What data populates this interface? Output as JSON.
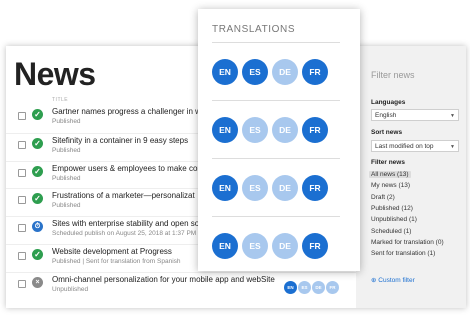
{
  "page": {
    "title": "News",
    "column_header": "TITLE"
  },
  "news": [
    {
      "title": "Gartner names progress a challenger in web",
      "status": "Published",
      "state": "published"
    },
    {
      "title": "Sitefinity in a container in 9 easy steps",
      "status": "Published",
      "state": "published"
    },
    {
      "title": "Empower users & employees to make conte",
      "status": "Published",
      "state": "published"
    },
    {
      "title": "Frustrations of a marketer—personalizat",
      "status": "Published",
      "state": "published"
    },
    {
      "title": "Sites with enterprise stability and open sour",
      "status": "Scheduled publish on August 25, 2018 at 1:37 PM",
      "state": "scheduled"
    },
    {
      "title": "Website development at Progress",
      "status": "Published | Sent for translation from Spanish",
      "state": "published"
    },
    {
      "title": "Omni-channel personalization for your mobile app and webSite",
      "status": "Unpublished",
      "state": "unpublished"
    }
  ],
  "row_languages": [
    "EN",
    "ES",
    "DE",
    "FR"
  ],
  "translations": {
    "title": "TRANSLATIONS",
    "rows": [
      [
        {
          "lang": "EN",
          "active": true
        },
        {
          "lang": "ES",
          "active": true
        },
        {
          "lang": "DE",
          "active": false
        },
        {
          "lang": "FR",
          "active": true
        }
      ],
      [
        {
          "lang": "EN",
          "active": true
        },
        {
          "lang": "ES",
          "active": false
        },
        {
          "lang": "DE",
          "active": false
        },
        {
          "lang": "FR",
          "active": true
        }
      ],
      [
        {
          "lang": "EN",
          "active": true
        },
        {
          "lang": "ES",
          "active": false
        },
        {
          "lang": "DE",
          "active": false
        },
        {
          "lang": "FR",
          "active": true
        }
      ],
      [
        {
          "lang": "EN",
          "active": true
        },
        {
          "lang": "ES",
          "active": false
        },
        {
          "lang": "DE",
          "active": false
        },
        {
          "lang": "FR",
          "active": true
        }
      ]
    ]
  },
  "filter": {
    "title": "Filter news",
    "languages_label": "Languages",
    "language_value": "English",
    "sort_label": "Sort news",
    "sort_value": "Last modified on top",
    "filter_label": "Filter news",
    "options": [
      "All news (13)",
      "My news (13)",
      "Draft (2)",
      "Published (12)",
      "Unpublished (1)",
      "Scheduled (1)",
      "Marked for translation (0)",
      "Sent for translation (1)"
    ],
    "custom_filter": "Custom filter"
  },
  "colors": {
    "accent": "#1b6fd1",
    "accent_light": "#a8c8ee",
    "published": "#2e9e4f",
    "scheduled": "#2a73c9",
    "unpublished": "#8a8a8a"
  },
  "icons": {
    "published": "check-circle-icon",
    "scheduled": "clock-icon",
    "unpublished": "x-circle-icon",
    "custom": "plus-icon"
  }
}
